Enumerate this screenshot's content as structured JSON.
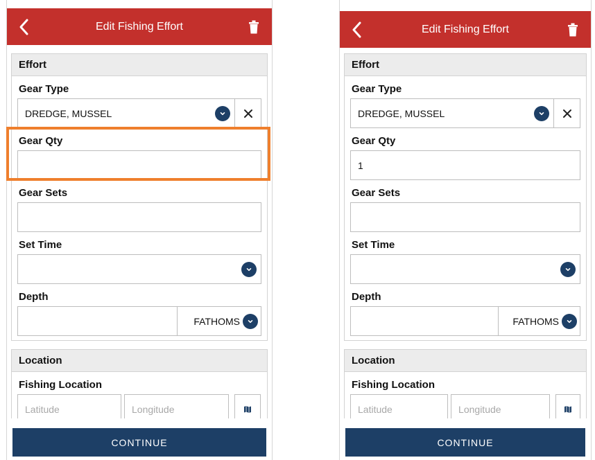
{
  "screens": [
    {
      "title": "Edit Fishing Effort",
      "effort_section": "Effort",
      "gear_type_label": "Gear Type",
      "gear_type_value": "DREDGE, MUSSEL",
      "gear_qty_label": "Gear Qty",
      "gear_qty_value": "",
      "gear_sets_label": "Gear Sets",
      "gear_sets_value": "",
      "set_time_label": "Set Time",
      "depth_label": "Depth",
      "depth_unit": "FATHOMS",
      "location_section": "Location",
      "fishing_location_label": "Fishing Location",
      "latitude_placeholder": "Latitude",
      "longitude_placeholder": "Longitude",
      "continue_label": "CONTINUE",
      "highlighted_field": "gear-qty"
    },
    {
      "title": "Edit Fishing Effort",
      "effort_section": "Effort",
      "gear_type_label": "Gear Type",
      "gear_type_value": "DREDGE, MUSSEL",
      "gear_qty_label": "Gear Qty",
      "gear_qty_value": "1",
      "gear_sets_label": "Gear Sets",
      "gear_sets_value": "",
      "set_time_label": "Set Time",
      "depth_label": "Depth",
      "depth_unit": "FATHOMS",
      "location_section": "Location",
      "fishing_location_label": "Fishing Location",
      "latitude_placeholder": "Latitude",
      "longitude_placeholder": "Longitude",
      "continue_label": "CONTINUE"
    }
  ],
  "colors": {
    "header_red": "#c3302c",
    "navy": "#1d3f66",
    "highlight_orange": "#ef7f2d"
  },
  "icons": [
    "back-chevron-icon",
    "trash-icon",
    "chevron-down-icon",
    "close-icon",
    "map-icon"
  ]
}
